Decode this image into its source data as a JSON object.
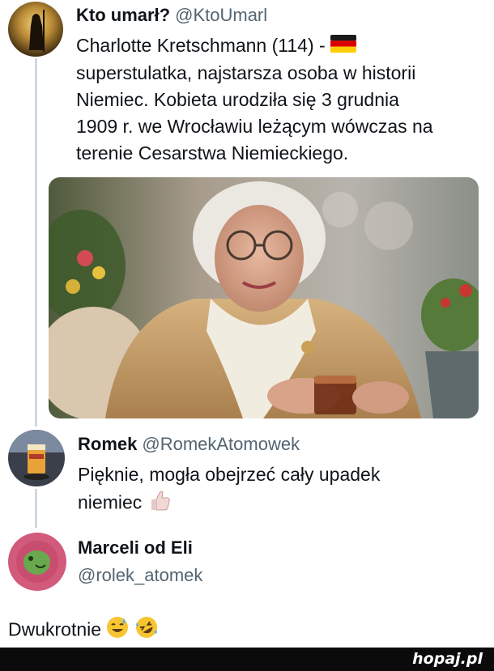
{
  "post1": {
    "display_name": "Kto umarł?",
    "handle": "@KtoUmarl",
    "text_lines": [
      "Charlotte Kretschmann (114) -",
      "superstulatka, najstarsza osoba w historii",
      "Niemiec. Kobieta urodziła się 3 grudnia",
      "1909 r. we Wrocławiu leżącym wówczas na",
      "terenie Cesarstwa Niemieckiego."
    ],
    "flag_icon": "germany-flag-icon"
  },
  "post2": {
    "display_name": "Romek",
    "handle": "@RomekAtomowek",
    "text_lines": [
      "Pięknie, mogła obejrzeć cały upadek",
      "niemiec"
    ],
    "emoji_icon": "thumbs-up-icon"
  },
  "post3": {
    "display_name": "Marceli od Eli",
    "handle": "@rolek_atomek"
  },
  "reply": {
    "text": "Dwukrotnie",
    "emoji_icons": [
      "sweat-smile-emoji-icon",
      "rofl-emoji-icon"
    ]
  },
  "footer": {
    "logo": "hopaj.pl"
  },
  "colors": {
    "thread_line": "#cfd9de",
    "handle_gray": "#536471",
    "footer_bg": "#0b0b0b"
  }
}
